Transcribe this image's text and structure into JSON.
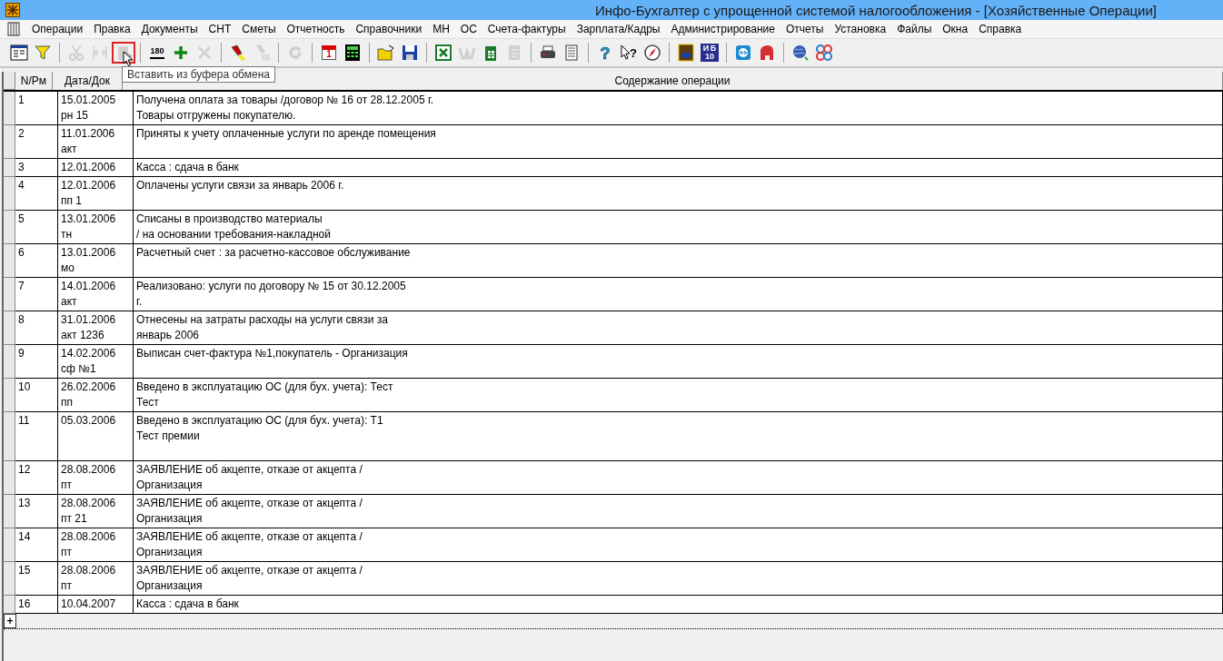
{
  "window": {
    "title": "Инфо-Бухгалтер с упрощенной системой налогообложения - [Хозяйственные Операции]"
  },
  "menu": [
    "Операции",
    "Правка",
    "Документы",
    "СНТ",
    "Сметы",
    "Отчетность",
    "Справочники",
    "МН",
    "ОС",
    "Счета-фактуры",
    "Зарплата/Кадры",
    "Администрирование",
    "Отчеты",
    "Установка",
    "Файлы",
    "Окна",
    "Справка"
  ],
  "toolbar": [
    [
      {
        "disabled": false
      },
      {
        "disabled": false
      }
    ],
    [
      {
        "disabled": true
      },
      {
        "disabled": true
      },
      {
        "disabled": true,
        "highlighted": true,
        "tooltip": "Вставить из буфера обмена"
      }
    ],
    [
      {
        "disabled": false,
        "label": "180"
      },
      {
        "disabled": false
      },
      {
        "disabled": true
      }
    ],
    [
      {
        "disabled": false
      },
      {
        "disabled": true
      }
    ],
    [
      {
        "disabled": true
      }
    ],
    [
      {
        "disabled": false,
        "label": "1"
      },
      {
        "disabled": false
      }
    ],
    [
      {
        "disabled": false
      },
      {
        "disabled": false
      }
    ],
    [
      {
        "disabled": false
      },
      {
        "disabled": true
      },
      {
        "disabled": false
      },
      {
        "disabled": true
      }
    ],
    [
      {
        "disabled": false
      },
      {
        "disabled": false
      }
    ],
    [
      {
        "disabled": false,
        "label": "?"
      },
      {
        "disabled": false,
        "label": "?"
      },
      {
        "disabled": false
      }
    ],
    [
      {
        "disabled": false
      },
      {
        "disabled": false,
        "label": "И Б 10"
      }
    ],
    [
      {
        "disabled": false
      },
      {
        "disabled": false
      }
    ],
    [
      {
        "disabled": false
      },
      {
        "disabled": false
      }
    ]
  ],
  "table": {
    "columns": [
      "N/Рм",
      "Дата/Док",
      "Содержание операции"
    ],
    "rows": [
      {
        "num": "1",
        "date": "15.01.2005",
        "doc": "рн 15",
        "content": [
          "Получена оплата за товары /договор № 16 от 28.12.2005 г.",
          "Товары отгружены покупателю."
        ]
      },
      {
        "num": "2",
        "date": "11.01.2006",
        "doc": "акт",
        "content": [
          "Приняты к учету оплаченные услуги по аренде помещения"
        ]
      },
      {
        "num": "3",
        "date": "12.01.2006",
        "content": [
          "Касса : сдача в банк"
        ]
      },
      {
        "num": "4",
        "date": "12.01.2006",
        "doc": "пп 1",
        "content": [
          "Оплачены услуги связи за январь 2006 г."
        ]
      },
      {
        "num": "5",
        "date": "13.01.2006",
        "doc": "тн",
        "content": [
          "Списаны в производство материалы",
          "/ на основании требования-накладной"
        ]
      },
      {
        "num": "6",
        "date": "13.01.2006",
        "doc": "мо",
        "content": [
          "Расчетный счет : за расчетно-кассовое обслуживание"
        ]
      },
      {
        "num": "7",
        "date": "14.01.2006",
        "doc": "акт",
        "content": [
          "Реализовано: услуги по договору № 15 от 30.12.2005",
          "г."
        ]
      },
      {
        "num": "8",
        "date": "31.01.2006",
        "doc": "акт 1236",
        "content": [
          "Отнесены на затраты расходы на услуги связи за",
          "январь 2006"
        ]
      },
      {
        "num": "9",
        "date": "14.02.2006",
        "doc": "сф №1",
        "content": [
          "Выписан счет-фактура №1,покупатель - Организация"
        ]
      },
      {
        "num": "10",
        "date": "26.02.2006",
        "doc": "пп",
        "content": [
          "Введено в эксплуатацию ОС (для бух. учета): Тест",
          "Тест"
        ]
      },
      {
        "num": "11",
        "date": "05.03.2006",
        "content": [
          "Введено в эксплуатацию ОС (для бух. учета): Т1",
          "Тест премии"
        ]
      },
      {
        "num": "12",
        "date": "28.08.2006",
        "doc": "пт",
        "content": [
          "ЗАЯВЛЕНИЕ об акцепте, отказе от акцепта /",
          "Организация"
        ]
      },
      {
        "num": "13",
        "date": "28.08.2006",
        "doc": "пт 21",
        "content": [
          "ЗАЯВЛЕНИЕ об акцепте, отказе от акцепта /",
          "Организация"
        ]
      },
      {
        "num": "14",
        "date": "28.08.2006",
        "doc": "пт",
        "content": [
          "ЗАЯВЛЕНИЕ об акцепте, отказе от акцепта /",
          "Организация"
        ]
      },
      {
        "num": "15",
        "date": "28.08.2006",
        "doc": "пт",
        "content": [
          "ЗАЯВЛЕНИЕ об акцепте, отказе от акцепта /",
          "Организация"
        ]
      },
      {
        "num": "16",
        "date": "10.04.2007",
        "content": [
          "Касса : сдача в банк"
        ]
      }
    ],
    "new_row_marker": "+"
  }
}
